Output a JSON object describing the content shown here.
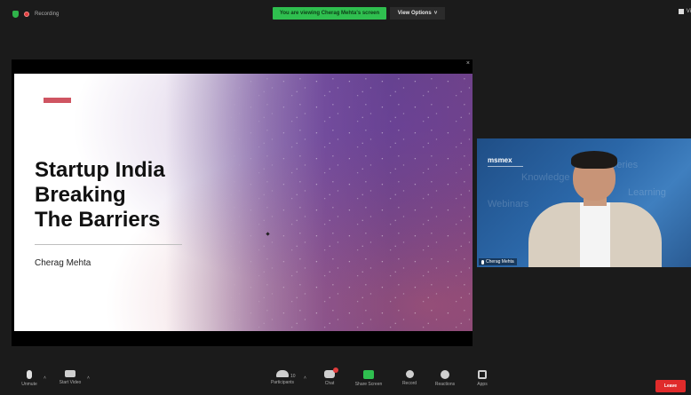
{
  "topbar": {
    "recording_label": "Recording",
    "share_banner": "You are viewing Cherag Mehta's screen",
    "view_options": "View Options",
    "view_caret": "˅",
    "view_label": "Vi"
  },
  "shared_screen": {
    "close_glyph": "×",
    "slide": {
      "title_lines": [
        "Startup India",
        "Breaking",
        "The Barriers"
      ],
      "author": "Cherag Mehta"
    }
  },
  "speaker": {
    "logo_text": "msmex",
    "background_words": [
      "Knowledge",
      "Webinars",
      "Learning",
      "Series"
    ],
    "name": "Cherag Mehta"
  },
  "toolbar": {
    "unmute_label": "Unmute",
    "start_video_label": "Start Video",
    "participants_label": "Participants",
    "participants_count": "10",
    "chat_label": "Chat",
    "share_screen_label": "Share Screen",
    "record_label": "Record",
    "reactions_label": "Reactions",
    "apps_label": "Apps",
    "leave_label": "Leave",
    "caret": "˄"
  },
  "colors": {
    "share_green": "#2fbf4f",
    "leave_red": "#e02b2b",
    "slide_accent": "#cf5562"
  }
}
